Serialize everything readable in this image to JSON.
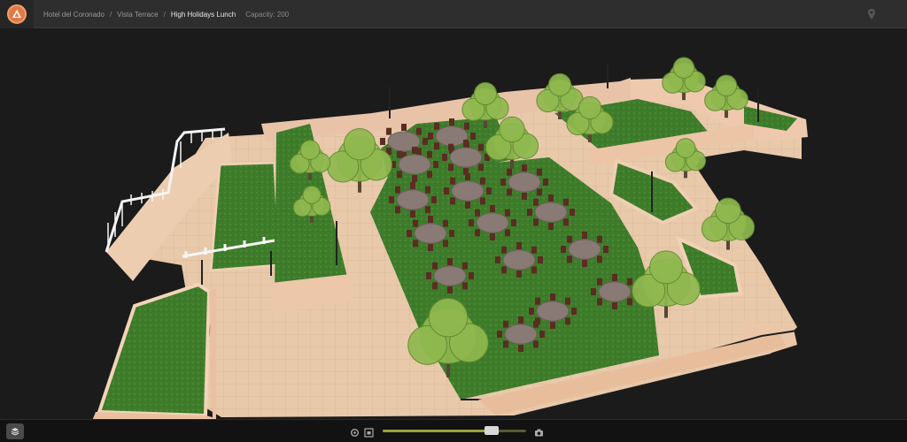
{
  "app": {
    "logo_icon": "app-logo-icon"
  },
  "breadcrumb": {
    "venue": "Hotel del Coronado",
    "space": "Vista Terrace",
    "event": "High Holidays Lunch",
    "separator": "/",
    "capacity": "Capacity: 200"
  },
  "header": {
    "right_icon": "location-pin-icon"
  },
  "viewer": {
    "content": "3d-floorplan-render",
    "accent": "#e07a45",
    "lawn_color": "#3c7a2a",
    "paving_color": "#e6c6a6"
  },
  "toolbar": {
    "layers_icon": "layers-icon",
    "settings_icon": "gear-icon",
    "fit_icon": "frame-icon",
    "camera_icon": "camera-icon",
    "zoom_level": 0.76
  }
}
